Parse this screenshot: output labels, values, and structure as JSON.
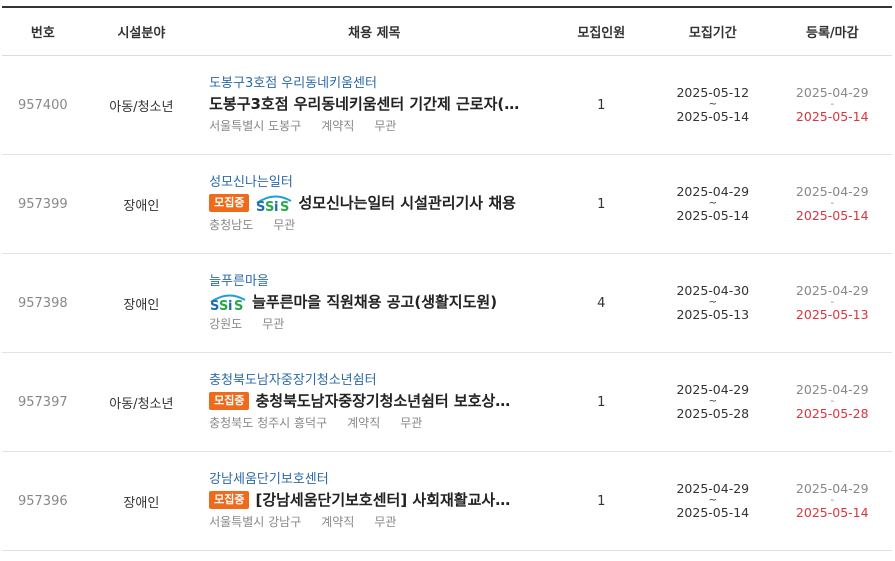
{
  "header": {
    "num": "번호",
    "field": "시설분야",
    "title": "채용 제목",
    "count": "모집인원",
    "period": "모집기간",
    "reg": "등록/마감"
  },
  "rows": [
    {
      "num": "957400",
      "field": "아동/청소년",
      "org": "도봉구3호점 우리동네키움센터",
      "title": "도봉구3호점 우리동네키움센터 기간제 근로자(…",
      "badge": "",
      "ssis": false,
      "meta": [
        "서울특별시 도봉구",
        "계약직",
        "무관"
      ],
      "count": "1",
      "period_start": "2025-05-12",
      "period_sep": "~",
      "period_end": "2025-05-14",
      "reg_date": "2025-04-29",
      "reg_sep": "-",
      "close_date": "2025-05-14"
    },
    {
      "num": "957399",
      "field": "장애인",
      "org": "성모신나는일터",
      "title": "성모신나는일터 시설관리기사 채용",
      "badge": "모집중",
      "ssis": true,
      "meta": [
        "충청남도",
        "무관"
      ],
      "count": "1",
      "period_start": "2025-04-29",
      "period_sep": "~",
      "period_end": "2025-05-14",
      "reg_date": "2025-04-29",
      "reg_sep": "-",
      "close_date": "2025-05-14"
    },
    {
      "num": "957398",
      "field": "장애인",
      "org": "늘푸른마을",
      "title": "늘푸른마을 직원채용 공고(생활지도원)",
      "badge": "",
      "ssis": true,
      "meta": [
        "강원도",
        "무관"
      ],
      "count": "4",
      "period_start": "2025-04-30",
      "period_sep": "~",
      "period_end": "2025-05-13",
      "reg_date": "2025-04-29",
      "reg_sep": "-",
      "close_date": "2025-05-13"
    },
    {
      "num": "957397",
      "field": "아동/청소년",
      "org": "충청북도남자중장기청소년쉼터",
      "title": "충청북도남자중장기청소년쉼터 보호상…",
      "badge": "모집중",
      "ssis": false,
      "meta": [
        "충청북도 청주시 흥덕구",
        "계약직",
        "무관"
      ],
      "count": "1",
      "period_start": "2025-04-29",
      "period_sep": "~",
      "period_end": "2025-05-28",
      "reg_date": "2025-04-29",
      "reg_sep": "-",
      "close_date": "2025-05-28"
    },
    {
      "num": "957396",
      "field": "장애인",
      "org": "강남세움단기보호센터",
      "title": "[강남세움단기보호센터] 사회재활교사…",
      "badge": "모집중",
      "ssis": false,
      "meta": [
        "서울특별시 강남구",
        "계약직",
        "무관"
      ],
      "count": "1",
      "period_start": "2025-04-29",
      "period_sep": "~",
      "period_end": "2025-05-14",
      "reg_date": "2025-04-29",
      "reg_sep": "-",
      "close_date": "2025-05-14"
    }
  ],
  "icons": {
    "ssis": "ssis-logo-icon"
  },
  "colors": {
    "badge": "#f06a1b",
    "org": "#2b6aa8",
    "close": "#d9363e"
  }
}
